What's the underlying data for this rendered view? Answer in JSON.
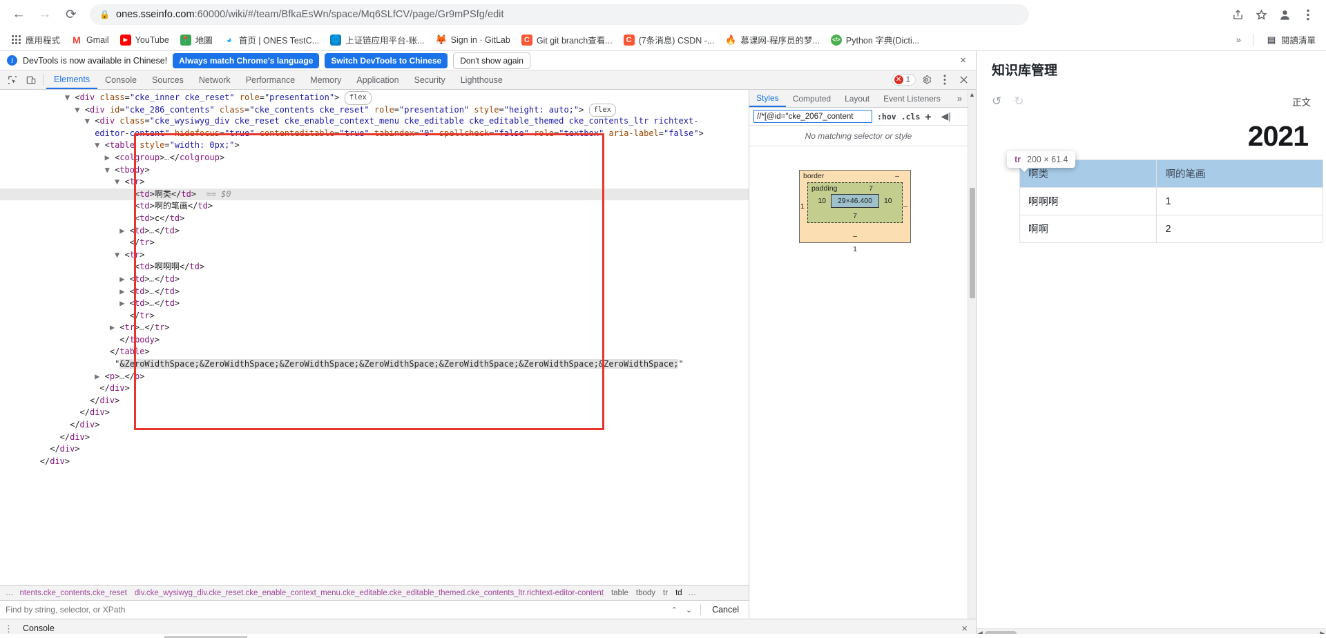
{
  "browser": {
    "nav": {
      "back": "←",
      "forward": "→",
      "reload": "⟳"
    },
    "omnibox": {
      "lock_icon": "lock-icon",
      "url_prefix": "ones.sseinfo.com",
      "url_rest": ":60000/wiki/#/team/BfkaEsWn/space/Mq6SLfCV/page/Gr9mPSfg/edit"
    },
    "toolbar_icons": [
      "share-icon",
      "bookmark-star-icon",
      "profile-avatar-icon",
      "chrome-menu-icon"
    ],
    "bookmarks": [
      {
        "label": "應用程式",
        "icon": "apps-grid-icon",
        "color": "#5f6368"
      },
      {
        "label": "Gmail",
        "icon": "gmail-icon",
        "color": "#ea4335"
      },
      {
        "label": "YouTube",
        "icon": "youtube-icon",
        "color": "#ff0000"
      },
      {
        "label": "地圖",
        "icon": "maps-icon",
        "color": "#34a853"
      },
      {
        "label": "首页 | ONES TestC...",
        "icon": "ones-icon",
        "color": "#1ab3ff"
      },
      {
        "label": "上证链应用平台-账...",
        "icon": "globe-icon",
        "color": "#0b7ec4"
      },
      {
        "label": "Sign in · GitLab",
        "icon": "gitlab-icon",
        "color": "#fc6d26"
      },
      {
        "label": "Git git branch查看...",
        "icon": "csdn-icon",
        "color": "#fc5531"
      },
      {
        "label": "(7条消息) CSDN -...",
        "icon": "csdn-icon",
        "color": "#fc5531"
      },
      {
        "label": "慕课网-程序员的梦...",
        "icon": "imooc-flame-icon",
        "color": "#e8453c"
      },
      {
        "label": "Python 字典(Dicti...",
        "icon": "runoob-icon",
        "color": "#4caf50"
      }
    ],
    "bookmarks_overflow": "»",
    "reading_list": {
      "label": "閱讀清單",
      "icon": "reading-list-icon"
    }
  },
  "devtools": {
    "banner": {
      "message": "DevTools is now available in Chinese!",
      "primary_button": "Always match Chrome's language",
      "secondary_button": "Switch DevTools to Chinese",
      "tertiary_button": "Don't show again",
      "close": "×"
    },
    "tabs": [
      {
        "label": "Elements",
        "active": true
      },
      {
        "label": "Console",
        "active": false
      },
      {
        "label": "Sources",
        "active": false
      },
      {
        "label": "Network",
        "active": false
      },
      {
        "label": "Performance",
        "active": false
      },
      {
        "label": "Memory",
        "active": false
      },
      {
        "label": "Application",
        "active": false
      },
      {
        "label": "Security",
        "active": false
      },
      {
        "label": "Lighthouse",
        "active": false
      }
    ],
    "error_count": "1",
    "dom_lines": [
      {
        "indent": 13,
        "arrow": "▼",
        "html": "<span class=\"pn\">&lt;</span><span class=\"tg\">div</span> <span class=\"at\">class</span>=<span class=\"av\">\"cke_inner cke_reset\"</span> <span class=\"at\">role</span>=<span class=\"av\">\"presentation\"</span><span class=\"pn\">&gt;</span> <span class=\"flexbadge\">flex</span>"
      },
      {
        "indent": 15,
        "arrow": "▼",
        "html": "<span class=\"pn\">&lt;</span><span class=\"tg\">div</span> <span class=\"at\">id</span>=<span class=\"av\">\"cke_286_contents\"</span> <span class=\"at\">class</span>=<span class=\"av\">\"cke_contents cke_reset\"</span> <span class=\"at\">role</span>=<span class=\"av\">\"presentation\"</span> <span class=\"at\">style</span>=<span class=\"av\">\"height: auto;\"</span><span class=\"pn\">&gt;</span> <span class=\"flexbadge\">flex</span>"
      },
      {
        "indent": 17,
        "arrow": "▼",
        "html": "<span class=\"pn\">&lt;</span><span class=\"tg\">div</span> <span class=\"at\">class</span>=<span class=\"av\">\"cke_wysiwyg_div cke_reset cke_enable_context_menu cke_editable cke_editable_themed cke_contents_ltr richtext-</span>"
      },
      {
        "indent": 17,
        "arrow": "",
        "html": "<span class=\"av\">editor-content\"</span> <span class=\"at\">hidefocus</span>=<span class=\"av\">\"true\"</span> <span class=\"at\">contenteditable</span>=<span class=\"av\">\"true\"</span> <span class=\"at\">tabindex</span>=<span class=\"av\">\"0\"</span> <span class=\"at\">spellcheck</span>=<span class=\"av\">\"false\"</span> <span class=\"at\">role</span>=<span class=\"av\">\"textbox\"</span> <span class=\"at\">aria-label</span>=<span class=\"av\">\"false\"</span><span class=\"pn\">&gt;</span>",
        "nopad": true
      },
      {
        "indent": 19,
        "arrow": "▼",
        "html": "<span class=\"pn\">&lt;</span><span class=\"tg\">table</span> <span class=\"at\">style</span>=<span class=\"av\">\"width: 0px;\"</span><span class=\"pn\">&gt;</span>"
      },
      {
        "indent": 21,
        "arrow": "▶",
        "html": "<span class=\"pn\">&lt;</span><span class=\"tg\">colgroup</span><span class=\"pn\">&gt;</span><span class=\"cmt\">…</span><span class=\"pn\">&lt;/</span><span class=\"tg\">colgroup</span><span class=\"pn\">&gt;</span>"
      },
      {
        "indent": 21,
        "arrow": "▼",
        "html": "<span class=\"pn\">&lt;</span><span class=\"tg\">tbody</span><span class=\"pn\">&gt;</span>"
      },
      {
        "indent": 23,
        "arrow": "▼",
        "html": "<span class=\"pn\">&lt;</span><span class=\"tg\">tr</span><span class=\"pn\">&gt;</span>"
      },
      {
        "indent": 25,
        "arrow": "",
        "selected": true,
        "html": "<span class=\"pn\">&lt;</span><span class=\"tg\">td</span><span class=\"pn\">&gt;</span><span class=\"txt\">啊类</span><span class=\"pn\">&lt;/</span><span class=\"tg\">td</span><span class=\"pn\">&gt;</span>  <span class=\"cmt\">== $0</span>"
      },
      {
        "indent": 25,
        "arrow": "",
        "html": "<span class=\"pn\">&lt;</span><span class=\"tg\">td</span><span class=\"pn\">&gt;</span><span class=\"txt\">啊的笔画</span><span class=\"pn\">&lt;/</span><span class=\"tg\">td</span><span class=\"pn\">&gt;</span>"
      },
      {
        "indent": 25,
        "arrow": "",
        "html": "<span class=\"pn\">&lt;</span><span class=\"tg\">td</span><span class=\"pn\">&gt;</span><span class=\"txt\">c</span><span class=\"pn\">&lt;/</span><span class=\"tg\">td</span><span class=\"pn\">&gt;</span>"
      },
      {
        "indent": 24,
        "arrow": "▶",
        "html": "<span class=\"pn\">&lt;</span><span class=\"tg\">td</span><span class=\"pn\">&gt;</span><span class=\"cmt\">…</span><span class=\"pn\">&lt;/</span><span class=\"tg\">td</span><span class=\"pn\">&gt;</span>"
      },
      {
        "indent": 24,
        "arrow": "",
        "html": "<span class=\"pn\">&lt;/</span><span class=\"tg\">tr</span><span class=\"pn\">&gt;</span>"
      },
      {
        "indent": 23,
        "arrow": "▼",
        "html": "<span class=\"pn\">&lt;</span><span class=\"tg\">tr</span><span class=\"pn\">&gt;</span>"
      },
      {
        "indent": 25,
        "arrow": "",
        "html": "<span class=\"pn\">&lt;</span><span class=\"tg\">td</span><span class=\"pn\">&gt;</span><span class=\"txt\">啊啊啊</span><span class=\"pn\">&lt;/</span><span class=\"tg\">td</span><span class=\"pn\">&gt;</span>"
      },
      {
        "indent": 24,
        "arrow": "▶",
        "html": "<span class=\"pn\">&lt;</span><span class=\"tg\">td</span><span class=\"pn\">&gt;</span><span class=\"cmt\">…</span><span class=\"pn\">&lt;/</span><span class=\"tg\">td</span><span class=\"pn\">&gt;</span>"
      },
      {
        "indent": 24,
        "arrow": "▶",
        "html": "<span class=\"pn\">&lt;</span><span class=\"tg\">td</span><span class=\"pn\">&gt;</span><span class=\"cmt\">…</span><span class=\"pn\">&lt;/</span><span class=\"tg\">td</span><span class=\"pn\">&gt;</span>"
      },
      {
        "indent": 24,
        "arrow": "▶",
        "html": "<span class=\"pn\">&lt;</span><span class=\"tg\">td</span><span class=\"pn\">&gt;</span><span class=\"cmt\">…</span><span class=\"pn\">&lt;/</span><span class=\"tg\">td</span><span class=\"pn\">&gt;</span>"
      },
      {
        "indent": 24,
        "arrow": "",
        "html": "<span class=\"pn\">&lt;/</span><span class=\"tg\">tr</span><span class=\"pn\">&gt;</span>"
      },
      {
        "indent": 22,
        "arrow": "▶",
        "html": "<span class=\"pn\">&lt;</span><span class=\"tg\">tr</span><span class=\"pn\">&gt;</span><span class=\"cmt\">…</span><span class=\"pn\">&lt;/</span><span class=\"tg\">tr</span><span class=\"pn\">&gt;</span>"
      },
      {
        "indent": 22,
        "arrow": "",
        "html": "<span class=\"pn\">&lt;/</span><span class=\"tg\">tbody</span><span class=\"pn\">&gt;</span>"
      },
      {
        "indent": 20,
        "arrow": "",
        "html": "<span class=\"pn\">&lt;/</span><span class=\"tg\">table</span><span class=\"pn\">&gt;</span>"
      },
      {
        "indent": 21,
        "arrow": "",
        "html": "<span class=\"txt\">\"</span><span class=\"zws-hl\">&amp;ZeroWidthSpace;&amp;ZeroWidthSpace;&amp;ZeroWidthSpace;&amp;ZeroWidthSpace;&amp;ZeroWidthSpace;&amp;ZeroWidthSpace;&amp;ZeroWidthSpace;</span><span class=\"txt\">\"</span>"
      },
      {
        "indent": 19,
        "arrow": "▶",
        "html": "<span class=\"pn\">&lt;</span><span class=\"tg\">p</span><span class=\"pn\">&gt;</span><span class=\"cmt\">…</span><span class=\"pn\">&lt;/</span><span class=\"tg\">p</span><span class=\"pn\">&gt;</span>"
      },
      {
        "indent": 18,
        "arrow": "",
        "html": "<span class=\"pn\">&lt;/</span><span class=\"tg\">div</span><span class=\"pn\">&gt;</span>"
      },
      {
        "indent": 16,
        "arrow": "",
        "html": "<span class=\"pn\">&lt;/</span><span class=\"tg\">div</span><span class=\"pn\">&gt;</span>"
      },
      {
        "indent": 14,
        "arrow": "",
        "html": "<span class=\"pn\">&lt;/</span><span class=\"tg\">div</span><span class=\"pn\">&gt;</span>"
      },
      {
        "indent": 12,
        "arrow": "",
        "html": "<span class=\"pn\">&lt;/</span><span class=\"tg\">div</span><span class=\"pn\">&gt;</span>"
      },
      {
        "indent": 10,
        "arrow": "",
        "html": "<span class=\"pn\">&lt;/</span><span class=\"tg\">div</span><span class=\"pn\">&gt;</span>"
      },
      {
        "indent": 8,
        "arrow": "",
        "html": "<span class=\"pn\">&lt;/</span><span class=\"tg\">div</span><span class=\"pn\">&gt;</span>"
      },
      {
        "indent": 6,
        "arrow": "",
        "html": "<span class=\"pn\">&lt;/</span><span class=\"tg\">div</span><span class=\"pn\">&gt;</span>"
      }
    ],
    "breadcrumb": [
      {
        "label": "…",
        "kind": "dots"
      },
      {
        "label": "ntents.cke_contents.cke_reset",
        "kind": "hl"
      },
      {
        "label": "div.cke_wysiwyg_div.cke_reset.cke_enable_context_menu.cke_editable.cke_editable_themed.cke_contents_ltr.richtext-editor-content",
        "kind": "hl"
      },
      {
        "label": "table",
        "kind": "plain"
      },
      {
        "label": "tbody",
        "kind": "plain"
      },
      {
        "label": "tr",
        "kind": "plain"
      },
      {
        "label": "td",
        "kind": "act"
      },
      {
        "label": "…",
        "kind": "dots"
      }
    ],
    "find": {
      "placeholder": "Find by string, selector, or XPath",
      "value": "",
      "prev": "⌃",
      "next": "⌄",
      "cancel": "Cancel"
    },
    "styles": {
      "tabs": [
        {
          "label": "Styles",
          "active": true
        },
        {
          "label": "Computed",
          "active": false
        },
        {
          "label": "Layout",
          "active": false
        },
        {
          "label": "Event Listeners",
          "active": false
        }
      ],
      "more": "»",
      "filter_value": "//*[@id=\"cke_2067_content",
      "hov_toggle": ":hov",
      "cls_toggle": ".cls",
      "new_rule": "+",
      "panel_toggle": "◀|",
      "no_match": "No matching selector or style",
      "box_model": {
        "border_label": "border",
        "border_top": "–",
        "border_left": "1",
        "border_right": "–",
        "border_bottom": "–",
        "padding_label": "padding",
        "padding_top": "7",
        "padding_left": "10",
        "padding_right": "10",
        "padding_bottom": "7",
        "content_size": "29×46.400",
        "outer_bottom": "1"
      }
    },
    "drawer": {
      "menu": "⋮",
      "tab": "Console",
      "close": "×"
    }
  },
  "page": {
    "title": "知识库管理",
    "toolbar": {
      "undo_icon": "undo-arrow-icon",
      "redo_icon": "redo-arrow-icon",
      "right_label": "正文"
    },
    "year": "2021",
    "tooltip": {
      "tag": "tr",
      "size": "200 × 61.4"
    },
    "table": {
      "rows": [
        {
          "selected": true,
          "cells": [
            "啊类",
            "啊的笔画"
          ]
        },
        {
          "selected": false,
          "cells": [
            "啊啊啊",
            "1"
          ]
        },
        {
          "selected": false,
          "cells": [
            "啊啊",
            "2"
          ]
        }
      ]
    }
  }
}
